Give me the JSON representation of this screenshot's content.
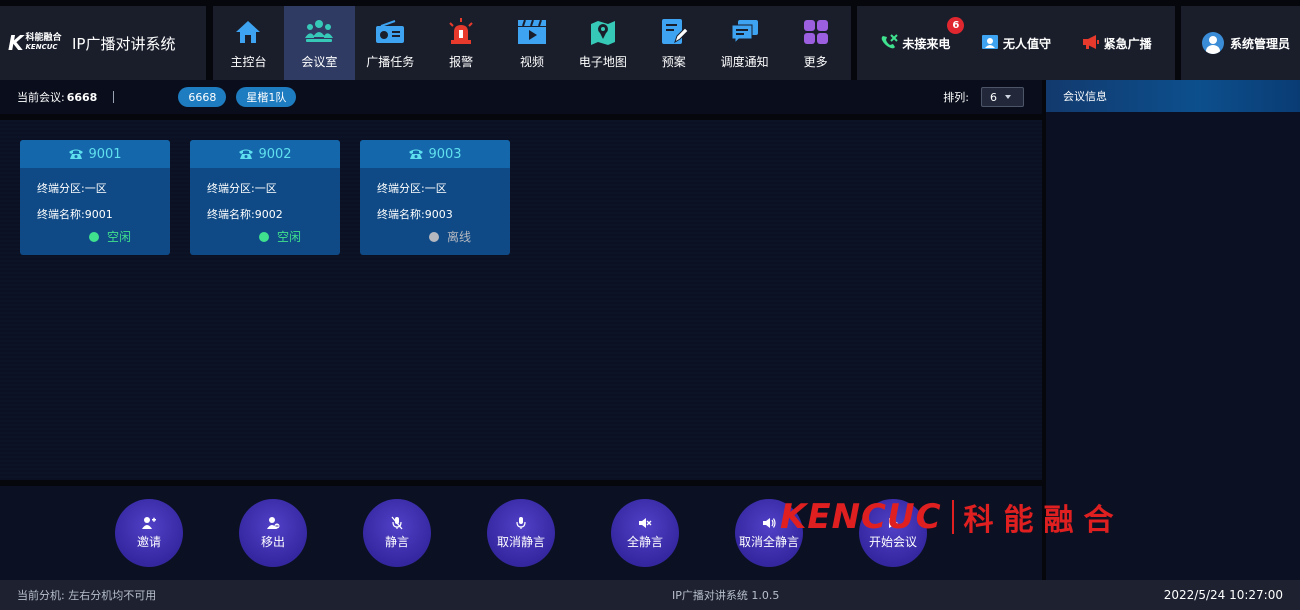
{
  "app": {
    "title": "IP广播对讲系统",
    "logo_text_cn": "科能融合",
    "logo_text_en": "KENCUC",
    "logo_mark": "K"
  },
  "nav": [
    {
      "label": "主控台",
      "icon": "home-icon",
      "color": "#3ea3f0",
      "active": false
    },
    {
      "label": "会议室",
      "icon": "meeting-people-icon",
      "color": "#37c9b8",
      "active": true
    },
    {
      "label": "广播任务",
      "icon": "radio-icon",
      "color": "#3ea3f0",
      "active": false
    },
    {
      "label": "报警",
      "icon": "alarm-siren-icon",
      "color": "#e83a2c",
      "active": false
    },
    {
      "label": "视频",
      "icon": "video-icon",
      "color": "#3ea3f0",
      "active": false
    },
    {
      "label": "电子地图",
      "icon": "map-icon",
      "color": "#37c9b8",
      "active": false
    },
    {
      "label": "预案",
      "icon": "plan-edit-icon",
      "color": "#3ea3f0",
      "active": false
    },
    {
      "label": "调度通知",
      "icon": "notice-icon",
      "color": "#3ea3f0",
      "active": false
    },
    {
      "label": "更多",
      "icon": "grid-more-icon",
      "color": "#9b5fe0",
      "active": false
    }
  ],
  "quick": {
    "missed_calls": {
      "label": "未接来电",
      "count": "6"
    },
    "unattended": {
      "label": "无人值守"
    },
    "emergency": {
      "label": "紧急广播"
    }
  },
  "user": {
    "name": "系统管理员"
  },
  "toolbar": {
    "current_label": "当前会议:",
    "current_value": "6668",
    "pills": [
      "6668",
      "星楷1队"
    ],
    "sort_label": "排列:",
    "sort_value": "6"
  },
  "terminals": [
    {
      "id": "9001",
      "zone_label": "终端分区:",
      "zone": "一区",
      "name_label": "终端名称:",
      "name": "9001",
      "status": "空闲",
      "status_type": "idle"
    },
    {
      "id": "9002",
      "zone_label": "终端分区:",
      "zone": "一区",
      "name_label": "终端名称:",
      "name": "9002",
      "status": "空闲",
      "status_type": "idle"
    },
    {
      "id": "9003",
      "zone_label": "终端分区:",
      "zone": "一区",
      "name_label": "终端名称:",
      "name": "9003",
      "status": "离线",
      "status_type": "offline"
    }
  ],
  "controls": [
    {
      "label": "邀请",
      "icon": "invite-user-icon"
    },
    {
      "label": "移出",
      "icon": "remove-user-icon"
    },
    {
      "label": "静言",
      "icon": "mic-off-icon"
    },
    {
      "label": "取消静言",
      "icon": "mic-icon"
    },
    {
      "label": "全静言",
      "icon": "speaker-mute-icon"
    },
    {
      "label": "取消全静言",
      "icon": "speaker-icon"
    },
    {
      "label": "开始会议",
      "icon": "start-icon"
    }
  ],
  "right_panel": {
    "title": "会议信息"
  },
  "footer": {
    "left": "当前分机: 左右分机均不可用",
    "center": "IP广播对讲系统 1.0.5",
    "right": "2022/5/24 10:27:00"
  },
  "watermark": {
    "latin": "KENCUC",
    "cn": "科能融合"
  }
}
